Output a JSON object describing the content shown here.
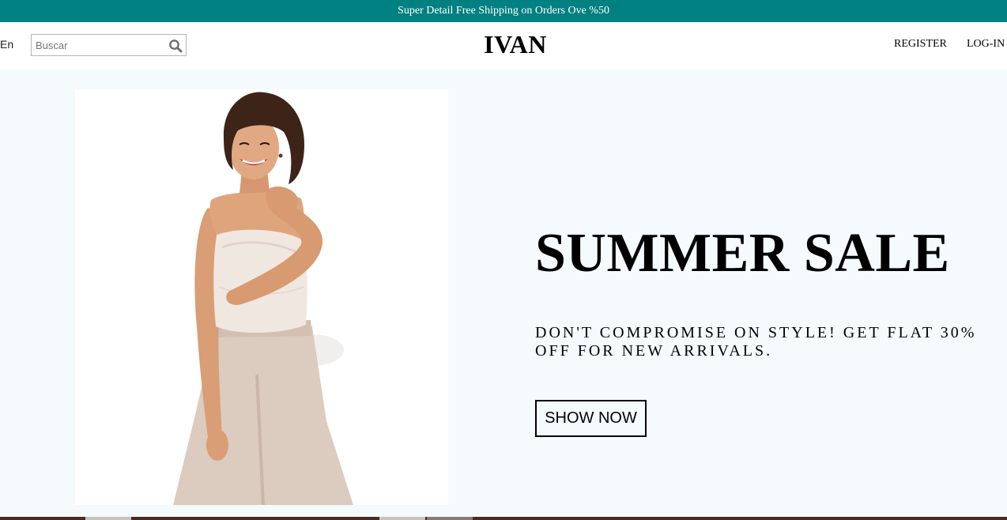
{
  "announcement": {
    "text": "Super Detail Free Shipping on Orders Ove %50"
  },
  "navbar": {
    "language": "En",
    "search_placeholder": "Buscar",
    "search_icon": "search-icon",
    "logo": "IVAN",
    "register_label": "REGISTER",
    "login_label": "LOG-IN"
  },
  "hero": {
    "title": "SUMMER SALE",
    "description": "DON'T COMPROMISE ON STYLE! GET FLAT 30% OFF FOR NEW ARRIVALS.",
    "button_label": "SHOW NOW",
    "image_subject": "woman-in-white-top-and-beige-trousers"
  },
  "colors": {
    "announcement_bg": "#008080",
    "hero_bg": "#f5fafd",
    "text": "#000000"
  }
}
